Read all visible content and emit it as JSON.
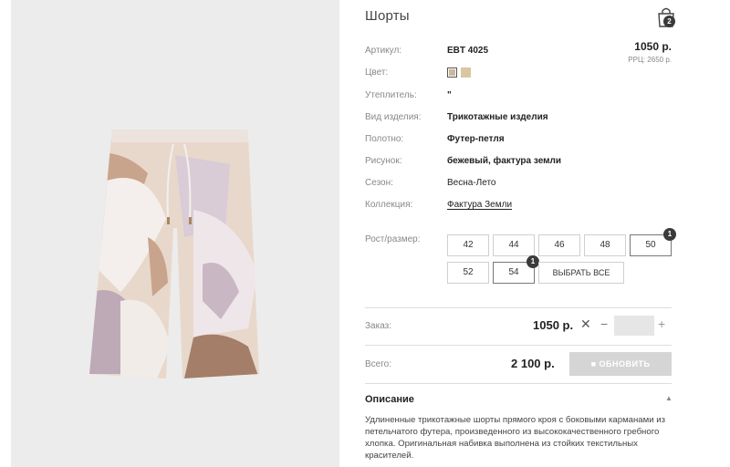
{
  "product": {
    "title": "Шорты",
    "price": "1050 р.",
    "rrp": "РРЦ: 2650 р."
  },
  "cart": {
    "icon": "shopping-bag-icon",
    "count": "2"
  },
  "attributes": [
    {
      "label": "Артикул:",
      "value": "EBT 4025"
    },
    {
      "label": "Цвет:",
      "value": ""
    },
    {
      "label": "Утеплитель:",
      "value": "\""
    },
    {
      "label": "Вид изделия:",
      "value": "Трикотажные изделия"
    },
    {
      "label": "Полотно:",
      "value": "Футер-петля"
    },
    {
      "label": "Рисунок:",
      "value": "бежевый, фактура земли"
    },
    {
      "label": "Сезон:",
      "value": "Весна-Лето"
    },
    {
      "label": "Коллекция:",
      "value": "Фактура Земли"
    }
  ],
  "colors": [
    "#c9b89a",
    "#d8c7a2"
  ],
  "sizes": {
    "label": "Рост/размер:",
    "options": [
      {
        "label": "42"
      },
      {
        "label": "44"
      },
      {
        "label": "46"
      },
      {
        "label": "48"
      },
      {
        "label": "50",
        "qty": "1"
      },
      {
        "label": "52"
      },
      {
        "label": "54",
        "qty": "1"
      }
    ],
    "select_all": "ВЫБРАТЬ ВСЕ"
  },
  "order": {
    "label": "Заказ:",
    "price": "1050 р.",
    "multiply": "✕",
    "minus": "−",
    "plus": "+",
    "qty": ""
  },
  "total": {
    "label": "Всего:",
    "value": "2 100 р.",
    "button": "ОБНОВИТЬ"
  },
  "description": {
    "title": "Описание",
    "text": "Удлиненные трикотажные шорты прямого кроя с боковыми карманами из петельчатого футера, произведенного из высококачественного гребного хлопка. Оригинальная набивка выполнена из стойких текстильных красителей."
  }
}
